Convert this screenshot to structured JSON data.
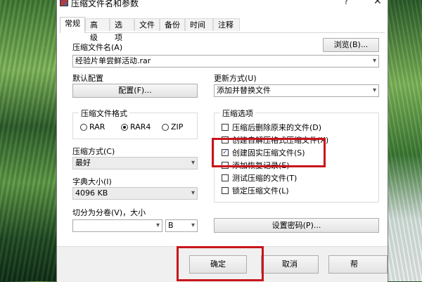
{
  "window": {
    "title": "压缩文件名和参数",
    "help": "?",
    "close": "✕"
  },
  "tabs": [
    "常规",
    "高级",
    "选项",
    "文件",
    "备份",
    "时间",
    "注释"
  ],
  "archive_name": {
    "label": "压缩文件名(A)",
    "value": "经验片单尝鲜活动.rar",
    "browse": "浏览(B)..."
  },
  "default_config": {
    "label": "默认配置",
    "button": "配置(F)..."
  },
  "update_method": {
    "label": "更新方式(U)",
    "value": "添加并替换文件"
  },
  "archive_format": {
    "label": "压缩文件格式",
    "options": [
      "RAR",
      "RAR4",
      "ZIP"
    ],
    "selected": "RAR4"
  },
  "compression_method": {
    "label": "压缩方式(C)",
    "value": "最好"
  },
  "dictionary_size": {
    "label": "字典大小(I)",
    "value": "4096 KB"
  },
  "split_volume": {
    "label": "切分为分卷(V)，大小",
    "value": "",
    "unit": "B"
  },
  "options_group": {
    "title": "压缩选项",
    "items": [
      {
        "label": "压缩后删除原来的文件(D)",
        "checked": false
      },
      {
        "label": "创建自解压格式压缩文件(X)",
        "checked": false
      },
      {
        "label": "创建固实压缩文件(S)",
        "checked": true
      },
      {
        "label": "添加恢复记录(E)",
        "checked": false
      },
      {
        "label": "测试压缩的文件(T)",
        "checked": false
      },
      {
        "label": "锁定压缩文件(L)",
        "checked": false
      }
    ]
  },
  "set_password": "设置密码(P)...",
  "footer": {
    "ok": "确定",
    "cancel": "取消",
    "help": "帮"
  },
  "icons": {
    "checkmark": "✓",
    "dropdown": "▾"
  },
  "colors": {
    "highlight": "#c8151b",
    "dialog_bg": "#ffffff",
    "footer_bg": "#f0f0f0"
  }
}
